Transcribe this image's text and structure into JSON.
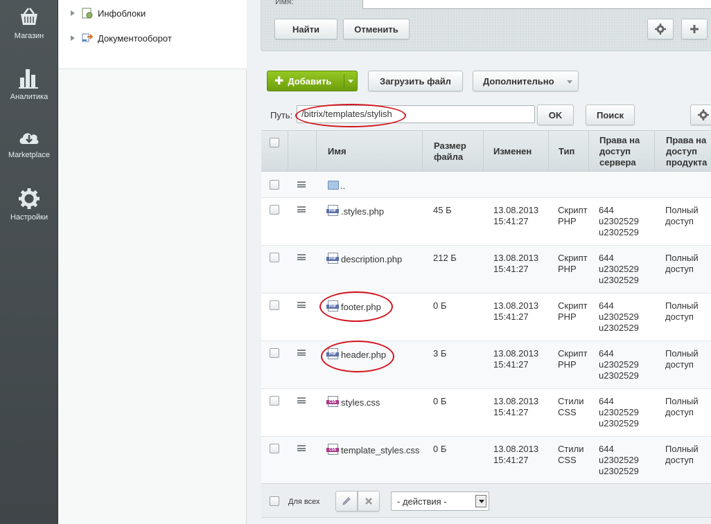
{
  "sidebar": {
    "items": [
      {
        "label": "Магазин",
        "icon": "basket-icon"
      },
      {
        "label": "Аналитика",
        "icon": "bar-chart-icon"
      },
      {
        "label": "Marketplace",
        "icon": "cloud-download-icon"
      },
      {
        "label": "Настройки",
        "icon": "gear-icon"
      }
    ]
  },
  "tree": {
    "items": [
      {
        "label": "Инфоблоки",
        "icon": "infoblock-icon"
      },
      {
        "label": "Документооборот",
        "icon": "workflow-icon"
      }
    ]
  },
  "filter": {
    "name_label": "Имя:",
    "find_label": "Найти",
    "cancel_label": "Отменить",
    "settings_icon": "gear-icon",
    "add_icon": "plus-icon"
  },
  "toolbar": {
    "add_label": "Добавить",
    "upload_label": "Загрузить файл",
    "more_label": "Дополнительно"
  },
  "path": {
    "label": "Путь:",
    "value": "/bitrix/templates/stylish",
    "ok_label": "OK",
    "search_label": "Поиск"
  },
  "table": {
    "headers": {
      "name": "Имя",
      "size_1": "Размер",
      "size_2": "файла",
      "modified": "Изменен",
      "type": "Тип",
      "server_rights_1": "Права на",
      "server_rights_2": "доступ",
      "server_rights_3": "сервера",
      "product_rights_1": "Права на",
      "product_rights_2": "доступ",
      "product_rights_3": "продукта"
    },
    "parent_row": {
      "name": ".."
    },
    "rows": [
      {
        "name": ".styles.php",
        "kind": "php",
        "size": "45 Б",
        "date": "13.08.2013",
        "time": "15:41:27",
        "type_1": "Скрипт",
        "type_2": "PHP",
        "perm": "644",
        "owner": "u2302529",
        "group": "u2302529",
        "access_1": "Полный",
        "access_2": "доступ"
      },
      {
        "name": "description.php",
        "kind": "php",
        "size": "212 Б",
        "date": "13.08.2013",
        "time": "15:41:27",
        "type_1": "Скрипт",
        "type_2": "PHP",
        "perm": "644",
        "owner": "u2302529",
        "group": "u2302529",
        "access_1": "Полный",
        "access_2": "доступ"
      },
      {
        "name": "footer.php",
        "kind": "php",
        "size": "0 Б",
        "date": "13.08.2013",
        "time": "15:41:27",
        "type_1": "Скрипт",
        "type_2": "PHP",
        "perm": "644",
        "owner": "u2302529",
        "group": "u2302529",
        "access_1": "Полный",
        "access_2": "доступ"
      },
      {
        "name": "header.php",
        "kind": "php",
        "size": "3 Б",
        "date": "13.08.2013",
        "time": "15:41:27",
        "type_1": "Скрипт",
        "type_2": "PHP",
        "perm": "644",
        "owner": "u2302529",
        "group": "u2302529",
        "access_1": "Полный",
        "access_2": "доступ"
      },
      {
        "name": "styles.css",
        "kind": "css",
        "size": "0 Б",
        "date": "13.08.2013",
        "time": "15:41:27",
        "type_1": "Стили",
        "type_2": "CSS",
        "perm": "644",
        "owner": "u2302529",
        "group": "u2302529",
        "access_1": "Полный",
        "access_2": "доступ"
      },
      {
        "name": "template_styles.css",
        "kind": "css",
        "size": "0 Б",
        "date": "13.08.2013",
        "time": "15:41:27",
        "type_1": "Стили",
        "type_2": "CSS",
        "perm": "644",
        "owner": "u2302529",
        "group": "u2302529",
        "access_1": "Полный",
        "access_2": "доступ"
      }
    ],
    "icon_labels": {
      "php": "PHP",
      "css": "CSS"
    }
  },
  "footer": {
    "for_all_label": "Для всех",
    "actions_value": "- действия -",
    "edit_icon": "pencil-icon",
    "delete_icon": "close-icon"
  },
  "colors": {
    "annotation": "#d3141d",
    "add_button": "#7fb21a",
    "sidebar": "#474e51"
  }
}
